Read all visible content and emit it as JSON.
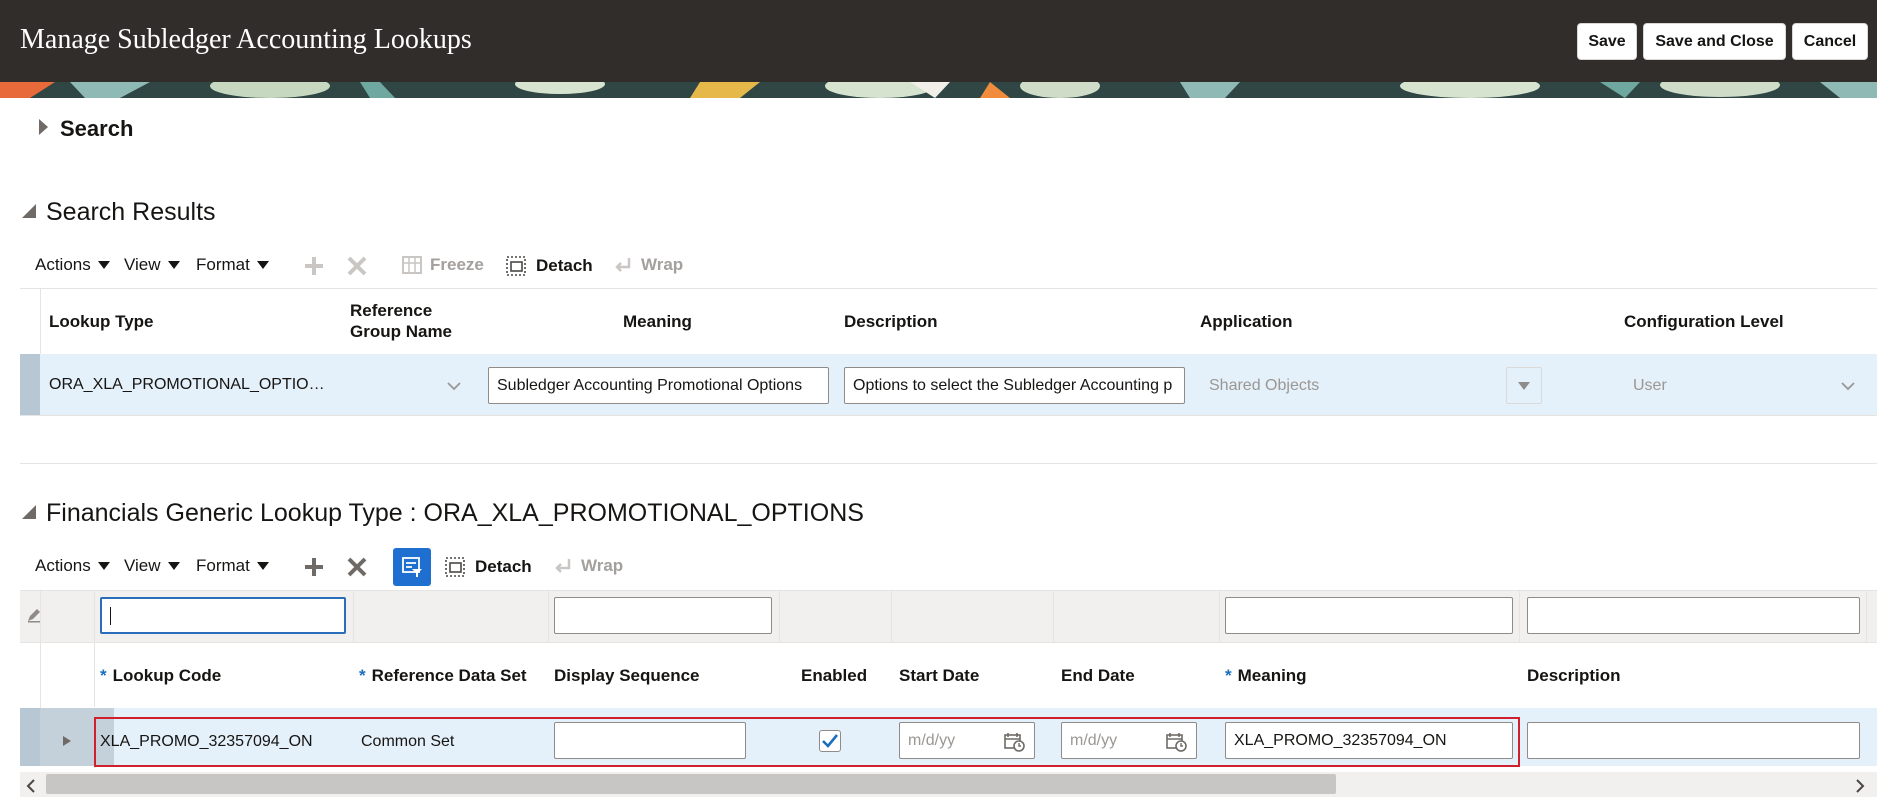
{
  "header": {
    "title": "Manage Subledger Accounting Lookups",
    "buttons": {
      "save": "Save",
      "save_and_close": "Save and Close",
      "cancel": "Cancel"
    }
  },
  "search": {
    "label": "Search"
  },
  "search_results": {
    "title": "Search Results",
    "toolbar": {
      "actions": "Actions",
      "view": "View",
      "format": "Format",
      "freeze": "Freeze",
      "detach": "Detach",
      "wrap": "Wrap"
    },
    "columns": {
      "lookup_type": "Lookup Type",
      "reference_group_line1": "Reference",
      "reference_group_line2": "Group Name",
      "meaning": "Meaning",
      "description": "Description",
      "application": "Application",
      "configuration_level": "Configuration Level"
    },
    "row": {
      "lookup_type": "ORA_XLA_PROMOTIONAL_OPTIO…",
      "reference_group": "",
      "meaning": "Subledger Accounting Promotional Options",
      "description": "Options to select the Subledger Accounting p",
      "application": "Shared Objects",
      "configuration_level": "User"
    }
  },
  "lookup_codes": {
    "title": "Financials Generic Lookup Type : ORA_XLA_PROMOTIONAL_OPTIONS",
    "toolbar": {
      "actions": "Actions",
      "view": "View",
      "format": "Format",
      "detach": "Detach",
      "wrap": "Wrap"
    },
    "filter_values": {
      "lookup_code": "",
      "display_sequence": "",
      "meaning": "",
      "description": ""
    },
    "columns": {
      "lookup_code": "Lookup Code",
      "reference_data_set": "Reference Data Set",
      "display_sequence": "Display Sequence",
      "enabled": "Enabled",
      "start_date": "Start Date",
      "end_date": "End Date",
      "meaning": "Meaning",
      "description": "Description"
    },
    "row": {
      "lookup_code": "XLA_PROMO_32357094_ON",
      "reference_data_set": "Common Set",
      "display_sequence": "",
      "enabled": true,
      "start_date_placeholder": "m/d/yy",
      "end_date_placeholder": "m/d/yy",
      "meaning": "XLA_PROMO_32357094_ON",
      "description": ""
    },
    "required_marker": "*"
  },
  "colors": {
    "header_bg": "#312d2a",
    "row_selected": "#e4f0fa",
    "highlight_outline": "#d0202e",
    "accent_blue": "#1a6ebd"
  }
}
